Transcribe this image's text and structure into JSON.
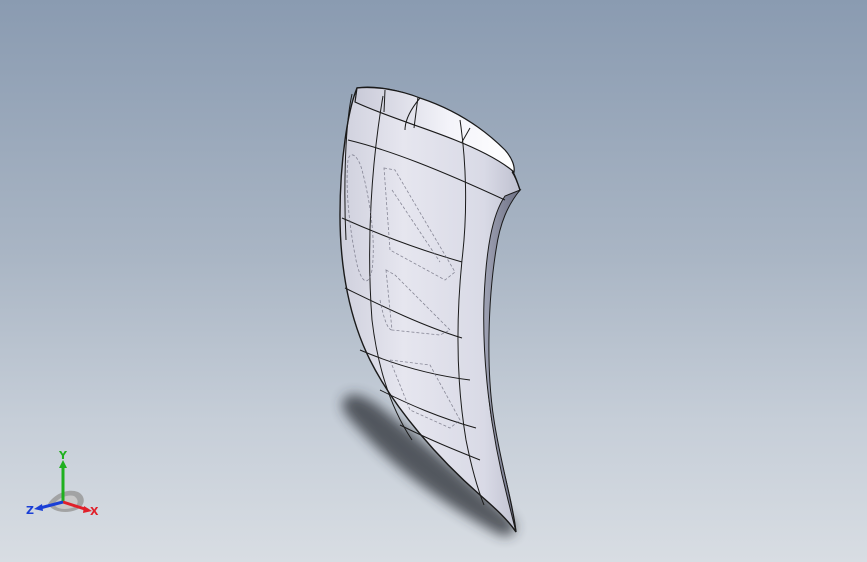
{
  "viewport": {
    "background_top": "#8a9bb1",
    "background_bottom": "#d8dde3"
  },
  "model": {
    "face_color": "#dfe0ea",
    "edge_color": "#1a1a1a",
    "shadow_color": "#2b2f36"
  },
  "triad": {
    "x_label": "X",
    "y_label": "Y",
    "z_label": "Z",
    "x_color": "#e0202a",
    "y_color": "#1fb01f",
    "z_color": "#1a3fd6"
  }
}
